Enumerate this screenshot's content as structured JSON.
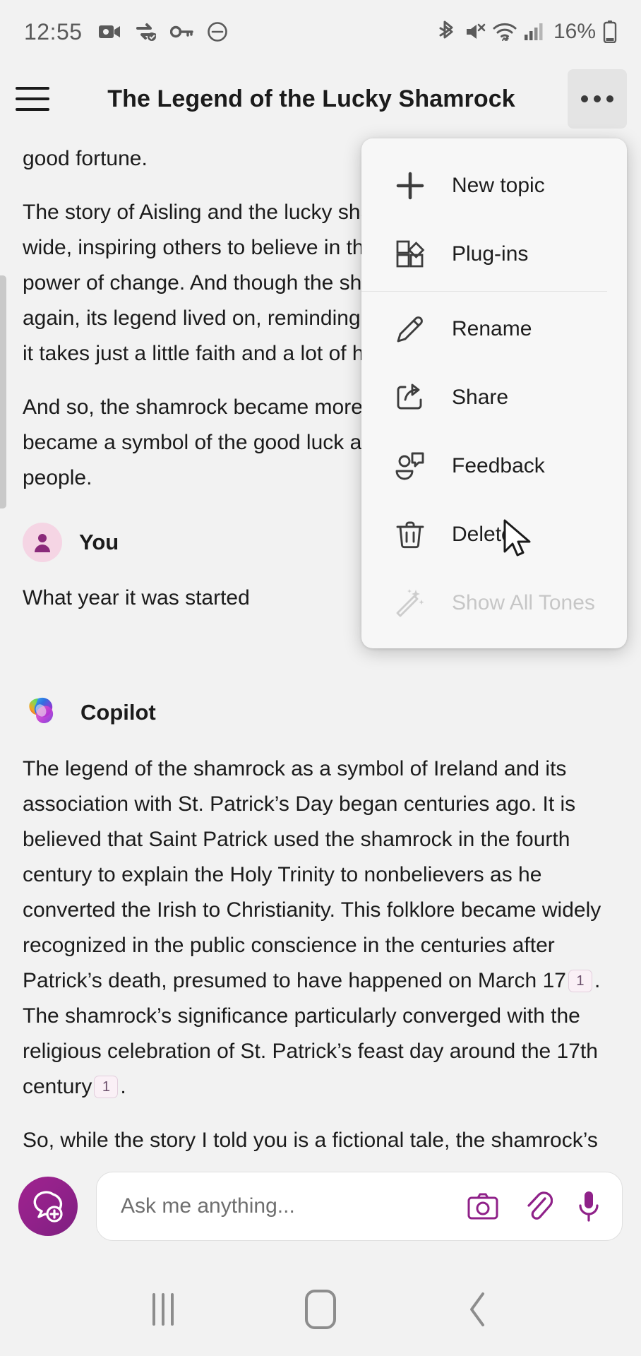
{
  "status_bar": {
    "time": "12:55",
    "battery_percent": "16%",
    "left_icons": [
      "video-camera-icon",
      "vpn-sync-icon",
      "key-icon",
      "do-not-disturb-icon"
    ],
    "right_icons": [
      "bluetooth-icon",
      "volume-muted-icon",
      "wifi-icon",
      "cellular-signal-icon",
      "battery-icon"
    ]
  },
  "header": {
    "title": "The Legend of the Lucky Shamrock",
    "menu_icon": "hamburger-icon",
    "more_icon": "more-options-icon"
  },
  "menu": {
    "items": [
      {
        "label": "New topic",
        "icon": "plus-icon",
        "disabled": false
      },
      {
        "label": "Plug-ins",
        "icon": "plugins-icon",
        "disabled": false
      },
      {
        "label": "Rename",
        "icon": "pencil-icon",
        "disabled": false
      },
      {
        "label": "Share",
        "icon": "share-icon",
        "disabled": false
      },
      {
        "label": "Feedback",
        "icon": "feedback-icon",
        "disabled": false
      },
      {
        "label": "Delete",
        "icon": "trash-icon",
        "disabled": false
      },
      {
        "label": "Show All Tones",
        "icon": "magic-wand-icon",
        "disabled": true
      }
    ]
  },
  "conversation": {
    "story_tail": {
      "para_0": "good fortune.",
      "para_1": "The story of Aisling and the lucky shamrock spread far and wide, inspiring others to believe in the magic of hope and the power of change. And though the shamrock was never seen again, its legend lived on, reminding everyone that sometimes it takes just a little faith and a lot of heart to find the luck within.",
      "para_2": "And so, the shamrock became more than just a plant — it became a symbol of the good luck and resilience of the Irish people."
    },
    "user_message": {
      "speaker": "You",
      "avatar": "person-avatar-icon",
      "text": "What year it was started"
    },
    "assistant_message": {
      "speaker": "Copilot",
      "avatar": "copilot-logo-icon",
      "para_1_a": "The legend of the shamrock as a symbol of Ireland and its association with St. Patrick’s Day began centuries ago. It is believed that Saint Patrick used the shamrock in the fourth century to explain the Holy Trinity to nonbelievers as he converted the Irish to Christianity. This folklore became widely recognized in the public conscience in the centuries after Patrick’s death, presumed to have happened on March 17",
      "citation_1": "1",
      "para_1_b": ". The shamrock’s significance particularly converged with the religious celebration of St. Patrick’s feast day around the 17th century",
      "citation_2": "1",
      "para_1_c": ".",
      "para_2": "So, while the story I told you is a fictional tale, the shamrock’s"
    }
  },
  "input_bar": {
    "new_chat_icon": "new-chat-icon",
    "placeholder": "Ask me anything...",
    "icons": [
      "camera-icon",
      "attachment-icon",
      "microphone-icon"
    ]
  },
  "nav_bar": {
    "recents": "recents-icon",
    "home": "home-icon",
    "back": "back-icon"
  },
  "colors": {
    "accent_purple": "#8f2189",
    "page_bg": "#f2f2f2",
    "text": "#1b1b1b",
    "citation_bg": "#faf0f6"
  }
}
